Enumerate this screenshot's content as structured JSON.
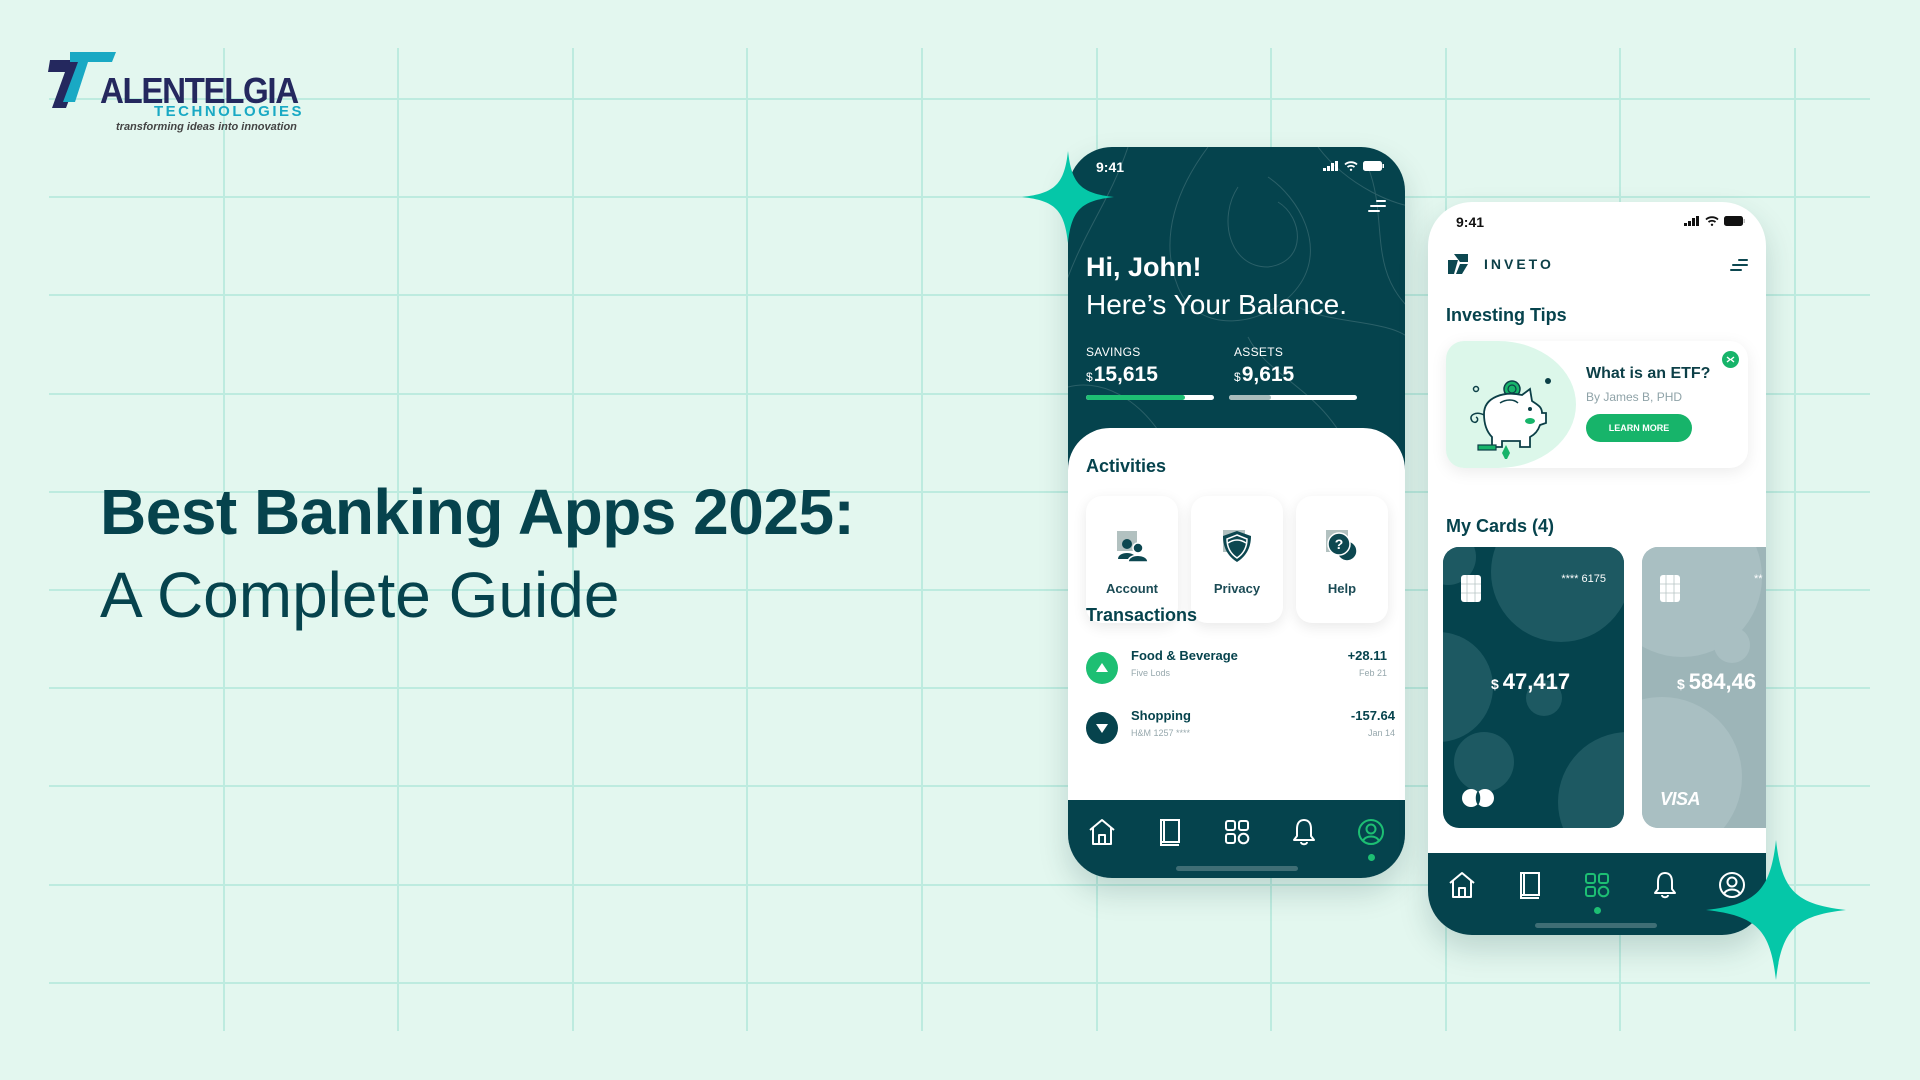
{
  "logo": {
    "name": "ALENTELGIA",
    "subtitle": "TECHNOLOGIES",
    "tagline": "transforming ideas into innovation"
  },
  "headline": {
    "line1": "Best Banking Apps 2025:",
    "line2": "A Complete Guide"
  },
  "colors": {
    "background": "#e3f7ef",
    "grid": "#bdebdf",
    "brand_dark": "#05434d",
    "accent_green": "#1dbf73",
    "star": "#05c7a8"
  },
  "phone1": {
    "status_time": "9:41",
    "greeting": "Hi, John!",
    "subtitle": "Here’s Your Balance.",
    "balances": [
      {
        "label": "SAVINGS",
        "currency": "$",
        "amount": "15,615",
        "progress": 0.77
      },
      {
        "label": "ASSETS",
        "currency": "$",
        "amount": "9,615",
        "progress": 0.33
      }
    ],
    "activities_title": "Activities",
    "activities": [
      {
        "label": "Account",
        "icon": "account-users-icon"
      },
      {
        "label": "Privacy",
        "icon": "shield-icon"
      },
      {
        "label": "Help",
        "icon": "help-chat-icon"
      }
    ],
    "transactions_title": "Transactions",
    "transactions": [
      {
        "name": "Food & Beverage",
        "merchant": "Five Lods",
        "amount": "+28.11",
        "date": "Feb 21",
        "direction": "up"
      },
      {
        "name": "Shopping",
        "merchant": "H&M 1257 ****",
        "amount": "-157.64",
        "date": "Jan 14",
        "direction": "down"
      }
    ],
    "nav": [
      "home-icon",
      "book-icon",
      "apps-grid-icon",
      "bell-icon",
      "profile-icon"
    ],
    "nav_active": 4
  },
  "phone2": {
    "status_time": "9:41",
    "brand": "INVETO",
    "tips_title": "Investing Tips",
    "tip": {
      "title": "What is an ETF?",
      "author": "By James B, PHD",
      "button": "LEARN MORE"
    },
    "cards_title": "My Cards (4)",
    "cards": [
      {
        "number": "**** 6175",
        "currency": "$",
        "balance": "47,417",
        "network": "mastercard"
      },
      {
        "number": "**",
        "currency": "$",
        "balance": "584,46",
        "network": "VISA"
      }
    ],
    "nav": [
      "home-icon",
      "book-icon",
      "apps-grid-icon",
      "bell-icon",
      "profile-icon"
    ],
    "nav_active": 2
  }
}
